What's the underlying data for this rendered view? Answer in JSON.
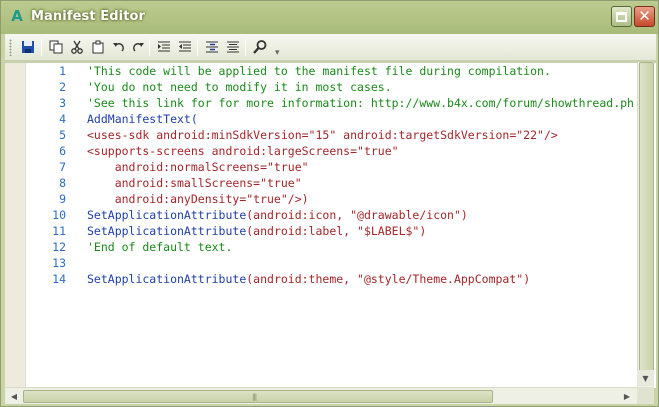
{
  "window": {
    "title": "Manifest Editor",
    "app_icon": "A"
  },
  "toolbar": {
    "items": [
      {
        "name": "save-icon"
      },
      {
        "name": "copy-icon"
      },
      {
        "name": "cut-icon"
      },
      {
        "name": "paste-icon"
      },
      {
        "name": "undo-icon"
      },
      {
        "name": "redo-icon"
      },
      {
        "name": "indent-icon"
      },
      {
        "name": "outdent-icon"
      },
      {
        "name": "comment-icon"
      },
      {
        "name": "uncomment-icon"
      },
      {
        "name": "search-icon"
      }
    ]
  },
  "code": {
    "lines": [
      {
        "n": "1",
        "segs": [
          {
            "t": "'This code will be applied to the manifest file during compilation.",
            "c": "c"
          }
        ]
      },
      {
        "n": "2",
        "segs": [
          {
            "t": "'You do not need to modify it in most cases.",
            "c": "c"
          }
        ]
      },
      {
        "n": "3",
        "segs": [
          {
            "t": "'See this link for for more information: http://www.b4x.com/forum/showthread.ph",
            "c": "c"
          }
        ]
      },
      {
        "n": "4",
        "segs": [
          {
            "t": "AddManifestText(",
            "c": "k"
          }
        ]
      },
      {
        "n": "5",
        "segs": [
          {
            "t": "<uses-sdk android:minSdkVersion=\"15\" android:targetSdkVersion=\"22\"/>",
            "c": "x"
          }
        ]
      },
      {
        "n": "6",
        "segs": [
          {
            "t": "<supports-screens android:largeScreens=\"true\"",
            "c": "x"
          }
        ]
      },
      {
        "n": "7",
        "segs": [
          {
            "t": "    android:normalScreens=\"true\"",
            "c": "x"
          }
        ]
      },
      {
        "n": "8",
        "segs": [
          {
            "t": "    android:smallScreens=\"true\"",
            "c": "x"
          }
        ]
      },
      {
        "n": "9",
        "segs": [
          {
            "t": "    android:anyDensity=\"true\"/>)",
            "c": "x"
          }
        ]
      },
      {
        "n": "10",
        "segs": [
          {
            "t": "SetApplicationAttribute",
            "c": "k"
          },
          {
            "t": "(android:icon, ",
            "c": "x"
          },
          {
            "t": "\"@drawable/icon\"",
            "c": "s"
          },
          {
            "t": ")",
            "c": "x"
          }
        ]
      },
      {
        "n": "11",
        "segs": [
          {
            "t": "SetApplicationAttribute",
            "c": "k"
          },
          {
            "t": "(android:label, ",
            "c": "x"
          },
          {
            "t": "\"$LABEL$\"",
            "c": "s"
          },
          {
            "t": ")",
            "c": "x"
          }
        ]
      },
      {
        "n": "12",
        "segs": [
          {
            "t": "'End of default text.",
            "c": "c"
          }
        ]
      },
      {
        "n": "13",
        "segs": [
          {
            "t": "",
            "c": "p"
          }
        ]
      },
      {
        "n": "14",
        "segs": [
          {
            "t": "SetApplicationAttribute",
            "c": "k"
          },
          {
            "t": "(android:theme, ",
            "c": "x"
          },
          {
            "t": "\"@style/Theme.AppCompat\"",
            "c": "s"
          },
          {
            "t": ")",
            "c": "x"
          }
        ]
      }
    ]
  },
  "colors": {
    "comment": "#1a8a1a",
    "keyword": "#1f3ea8",
    "xml": "#a3262a",
    "line_number": "#2b6cc4",
    "title_bar": "#a9bb79"
  }
}
